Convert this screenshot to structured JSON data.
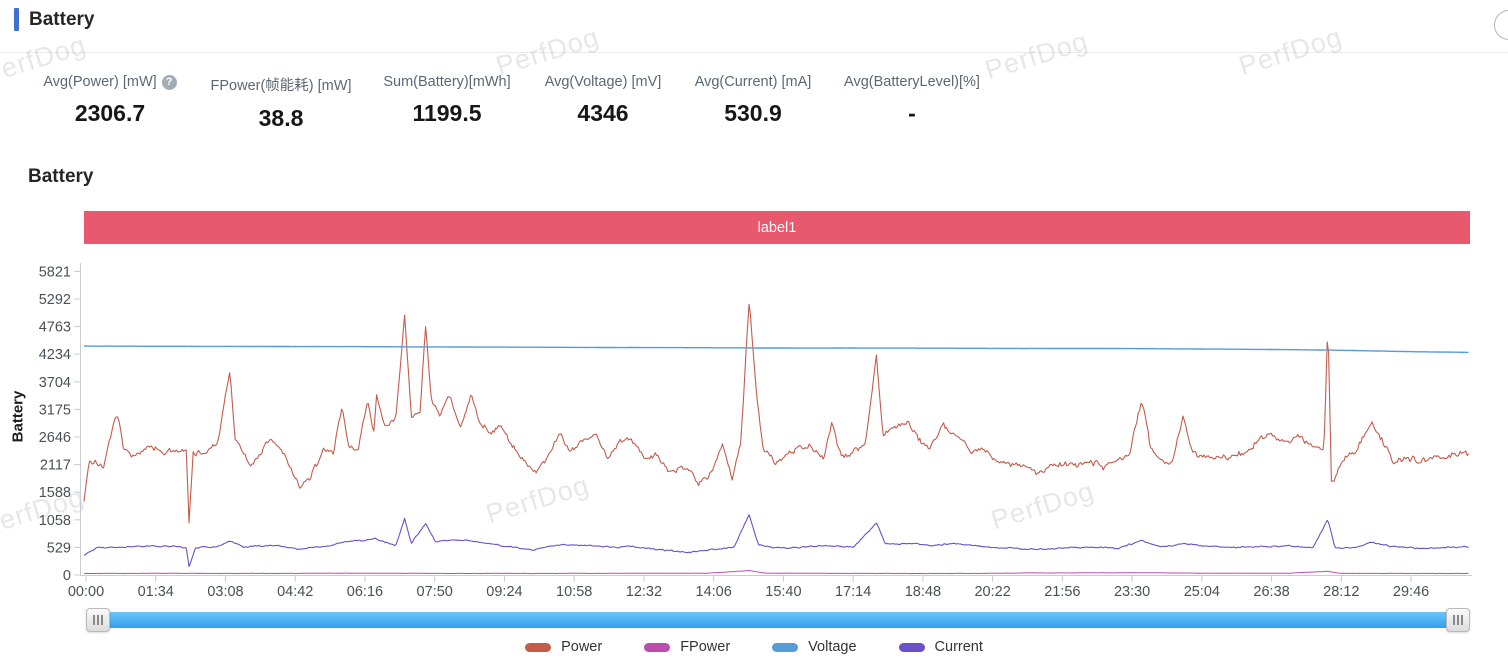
{
  "page_title": "Battery",
  "section_title": "Battery",
  "watermark": "PerfDog",
  "stats": {
    "help_icon": "?",
    "items": [
      {
        "label": "Avg(Power) [mW]",
        "value": "2306.7"
      },
      {
        "label": "FPower(帧能耗) [mW]",
        "value": "38.8"
      },
      {
        "label": "Sum(Battery)[mWh]",
        "value": "1199.5"
      },
      {
        "label": "Avg(Voltage) [mV]",
        "value": "4346"
      },
      {
        "label": "Avg(Current) [mA]",
        "value": "530.9"
      },
      {
        "label": "Avg(BatteryLevel)[%]",
        "value": "-"
      }
    ]
  },
  "chart_data": {
    "type": "line",
    "title": "Battery",
    "ylabel": "Battery",
    "ylim": [
      0,
      5821
    ],
    "y_ticks": [
      0,
      529,
      1058,
      1588,
      2117,
      2646,
      3175,
      3704,
      4234,
      4763,
      5292,
      5821
    ],
    "x_tick_labels": [
      "00:00",
      "01:34",
      "03:08",
      "04:42",
      "06:16",
      "07:50",
      "09:24",
      "10:58",
      "12:32",
      "14:06",
      "15:40",
      "17:14",
      "18:48",
      "20:22",
      "21:56",
      "23:30",
      "25:04",
      "26:38",
      "28:12",
      "29:46"
    ],
    "x_unit": "mm:ss",
    "x_range_minutes": [
      0,
      31.1
    ],
    "grid": false,
    "legend_position": "bottom",
    "annotation": {
      "label": "label1",
      "color": "#e8596d"
    },
    "series": [
      {
        "name": "Power",
        "color": "#c45c4c",
        "width": 1.1,
        "jitter_fast": 110,
        "jitter_slow": 170,
        "points": [
          [
            0,
            1450
          ],
          [
            0.12,
            2200
          ],
          [
            0.45,
            2100
          ],
          [
            0.74,
            3100
          ],
          [
            0.9,
            2300
          ],
          [
            1.2,
            2250
          ],
          [
            1.5,
            2350
          ],
          [
            1.8,
            2200
          ],
          [
            2.1,
            2350
          ],
          [
            2.3,
            2400
          ],
          [
            2.36,
            980
          ],
          [
            2.45,
            2350
          ],
          [
            2.7,
            2300
          ],
          [
            3.0,
            2500
          ],
          [
            3.28,
            3850
          ],
          [
            3.4,
            2550
          ],
          [
            3.6,
            2300
          ],
          [
            3.8,
            2050
          ],
          [
            4.0,
            2350
          ],
          [
            4.2,
            2500
          ],
          [
            4.5,
            2300
          ],
          [
            4.85,
            1620
          ],
          [
            5.1,
            1900
          ],
          [
            5.4,
            2450
          ],
          [
            5.6,
            2400
          ],
          [
            5.8,
            3350
          ],
          [
            5.95,
            2500
          ],
          [
            6.15,
            2400
          ],
          [
            6.37,
            3400
          ],
          [
            6.5,
            2700
          ],
          [
            6.57,
            3450
          ],
          [
            6.75,
            2800
          ],
          [
            7.0,
            2900
          ],
          [
            7.2,
            4950
          ],
          [
            7.35,
            2950
          ],
          [
            7.55,
            3100
          ],
          [
            7.67,
            4800
          ],
          [
            7.8,
            3300
          ],
          [
            8.0,
            3000
          ],
          [
            8.2,
            3450
          ],
          [
            8.45,
            2800
          ],
          [
            8.7,
            3350
          ],
          [
            8.9,
            2900
          ],
          [
            9.1,
            2750
          ],
          [
            9.35,
            2900
          ],
          [
            9.6,
            2500
          ],
          [
            9.85,
            2250
          ],
          [
            10.1,
            1950
          ],
          [
            10.4,
            2250
          ],
          [
            10.7,
            2700
          ],
          [
            10.95,
            2400
          ],
          [
            11.2,
            2600
          ],
          [
            11.5,
            2700
          ],
          [
            11.75,
            2250
          ],
          [
            12.0,
            2500
          ],
          [
            12.3,
            2600
          ],
          [
            12.6,
            2200
          ],
          [
            12.9,
            2350
          ],
          [
            13.2,
            1950
          ],
          [
            13.5,
            2100
          ],
          [
            13.8,
            1800
          ],
          [
            14.1,
            2000
          ],
          [
            14.35,
            2550
          ],
          [
            14.55,
            1850
          ],
          [
            14.75,
            2600
          ],
          [
            14.94,
            5280
          ],
          [
            15.1,
            3600
          ],
          [
            15.25,
            2450
          ],
          [
            15.5,
            2150
          ],
          [
            15.75,
            2250
          ],
          [
            16.0,
            2400
          ],
          [
            16.3,
            2500
          ],
          [
            16.6,
            2250
          ],
          [
            16.8,
            2900
          ],
          [
            17.0,
            2250
          ],
          [
            17.3,
            2350
          ],
          [
            17.55,
            2500
          ],
          [
            17.8,
            4230
          ],
          [
            17.95,
            2700
          ],
          [
            18.2,
            2900
          ],
          [
            18.5,
            2950
          ],
          [
            18.75,
            2600
          ],
          [
            19.0,
            2450
          ],
          [
            19.3,
            2900
          ],
          [
            19.6,
            2700
          ],
          [
            19.9,
            2450
          ],
          [
            20.2,
            2400
          ],
          [
            20.5,
            2250
          ],
          [
            20.8,
            2150
          ],
          [
            21.1,
            2100
          ],
          [
            21.4,
            1980
          ],
          [
            21.7,
            2100
          ],
          [
            22.0,
            2150
          ],
          [
            22.3,
            2080
          ],
          [
            22.6,
            2200
          ],
          [
            22.9,
            2150
          ],
          [
            23.2,
            2250
          ],
          [
            23.5,
            2400
          ],
          [
            23.76,
            3350
          ],
          [
            23.95,
            2500
          ],
          [
            24.2,
            2200
          ],
          [
            24.45,
            2150
          ],
          [
            24.68,
            3000
          ],
          [
            24.9,
            2350
          ],
          [
            25.2,
            2280
          ],
          [
            25.5,
            2250
          ],
          [
            25.8,
            2350
          ],
          [
            26.1,
            2450
          ],
          [
            26.4,
            2600
          ],
          [
            26.7,
            2700
          ],
          [
            27.0,
            2550
          ],
          [
            27.3,
            2700
          ],
          [
            27.6,
            2450
          ],
          [
            27.85,
            2400
          ],
          [
            27.94,
            4930
          ],
          [
            28.02,
            1780
          ],
          [
            28.3,
            2250
          ],
          [
            28.6,
            2450
          ],
          [
            28.9,
            2950
          ],
          [
            29.1,
            2700
          ],
          [
            29.4,
            2250
          ],
          [
            29.7,
            2300
          ],
          [
            30.0,
            2150
          ],
          [
            30.3,
            2300
          ],
          [
            30.6,
            2200
          ],
          [
            30.9,
            2350
          ],
          [
            31.15,
            2300
          ]
        ]
      },
      {
        "name": "FPower",
        "color": "#bc4cb0",
        "width": 1.0,
        "jitter_fast": 3.5,
        "jitter_slow": 4,
        "points": [
          [
            0,
            30
          ],
          [
            2,
            32
          ],
          [
            4,
            30
          ],
          [
            6,
            35
          ],
          [
            8,
            32
          ],
          [
            10,
            30
          ],
          [
            12,
            33
          ],
          [
            14,
            35
          ],
          [
            14.94,
            85
          ],
          [
            15.3,
            35
          ],
          [
            17,
            32
          ],
          [
            20,
            30
          ],
          [
            21,
            38
          ],
          [
            23,
            40
          ],
          [
            23.8,
            45
          ],
          [
            25,
            35
          ],
          [
            27,
            32
          ],
          [
            27.94,
            70
          ],
          [
            28.2,
            32
          ],
          [
            30,
            30
          ],
          [
            31.15,
            32
          ]
        ]
      },
      {
        "name": "Voltage",
        "color": "#569bd8",
        "width": 1.4,
        "jitter_fast": 1.2,
        "jitter_slow": 2,
        "points": [
          [
            0,
            4388
          ],
          [
            3,
            4383
          ],
          [
            6,
            4378
          ],
          [
            9,
            4370
          ],
          [
            12,
            4362
          ],
          [
            14.8,
            4356
          ],
          [
            15.2,
            4352
          ],
          [
            18,
            4350
          ],
          [
            21,
            4345
          ],
          [
            23,
            4342
          ],
          [
            24,
            4338
          ],
          [
            25.5,
            4330
          ],
          [
            27,
            4322
          ],
          [
            28,
            4312
          ],
          [
            29,
            4295
          ],
          [
            30,
            4280
          ],
          [
            31.15,
            4268
          ]
        ]
      },
      {
        "name": "Current",
        "color": "#6a51c9",
        "width": 1.1,
        "jitter_fast": 26,
        "jitter_slow": 36,
        "points": [
          [
            0,
            380
          ],
          [
            0.3,
            530
          ],
          [
            1,
            540
          ],
          [
            1.5,
            560
          ],
          [
            2.3,
            520
          ],
          [
            2.36,
            150
          ],
          [
            2.5,
            520
          ],
          [
            3,
            540
          ],
          [
            3.28,
            650
          ],
          [
            3.6,
            530
          ],
          [
            4.3,
            560
          ],
          [
            4.85,
            480
          ],
          [
            5.4,
            540
          ],
          [
            5.8,
            620
          ],
          [
            6.37,
            680
          ],
          [
            6.57,
            700
          ],
          [
            7.0,
            560
          ],
          [
            7.2,
            1090
          ],
          [
            7.35,
            600
          ],
          [
            7.67,
            980
          ],
          [
            7.9,
            640
          ],
          [
            8.2,
            680
          ],
          [
            8.7,
            650
          ],
          [
            9.1,
            600
          ],
          [
            9.6,
            560
          ],
          [
            10.1,
            480
          ],
          [
            10.7,
            580
          ],
          [
            11.2,
            560
          ],
          [
            11.75,
            520
          ],
          [
            12.3,
            560
          ],
          [
            12.9,
            500
          ],
          [
            13.5,
            460
          ],
          [
            14.1,
            500
          ],
          [
            14.6,
            540
          ],
          [
            14.94,
            1160
          ],
          [
            15.15,
            580
          ],
          [
            15.5,
            520
          ],
          [
            16,
            540
          ],
          [
            16.8,
            580
          ],
          [
            17.3,
            540
          ],
          [
            17.8,
            1000
          ],
          [
            18,
            600
          ],
          [
            18.5,
            620
          ],
          [
            19,
            580
          ],
          [
            19.6,
            600
          ],
          [
            20.2,
            540
          ],
          [
            20.8,
            520
          ],
          [
            21.4,
            490
          ],
          [
            22,
            520
          ],
          [
            22.6,
            540
          ],
          [
            23.2,
            520
          ],
          [
            23.76,
            660
          ],
          [
            24.2,
            540
          ],
          [
            24.68,
            600
          ],
          [
            25.2,
            540
          ],
          [
            25.8,
            520
          ],
          [
            26.4,
            560
          ],
          [
            27,
            580
          ],
          [
            27.6,
            540
          ],
          [
            27.94,
            1080
          ],
          [
            28.1,
            520
          ],
          [
            28.6,
            540
          ],
          [
            28.9,
            620
          ],
          [
            29.4,
            540
          ],
          [
            30,
            510
          ],
          [
            30.6,
            530
          ],
          [
            31.15,
            540
          ]
        ]
      }
    ]
  }
}
